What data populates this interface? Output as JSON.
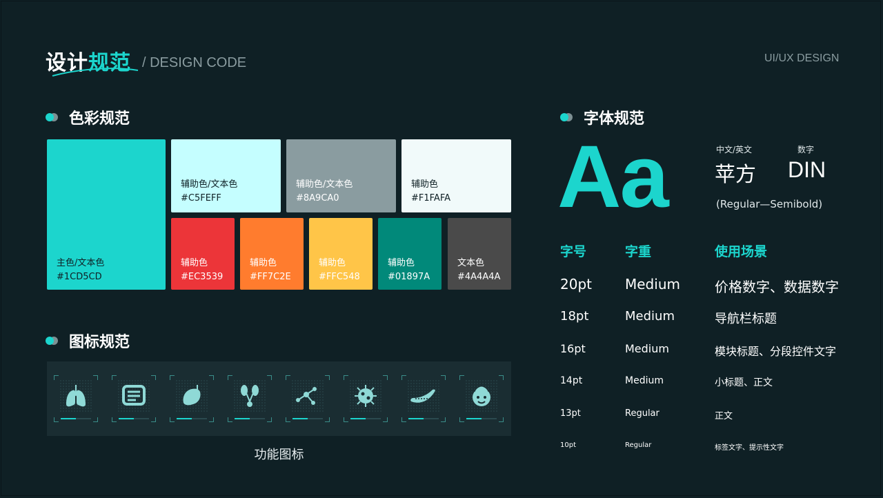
{
  "header": {
    "title_main": "设计",
    "title_accent": "规范",
    "subtitle": "/ DESIGN CODE",
    "right_label": "UI/UX DESIGN"
  },
  "colors_section": {
    "title": "色彩规范",
    "swatches": [
      {
        "name": "主色/文本色",
        "hex": "#1CD5CD",
        "bg": "#1CD5CD",
        "fg": "#0f2025"
      },
      {
        "name": "辅助色/文本色",
        "hex": "#C5FEFF",
        "bg": "#C5FEFF",
        "fg": "#0f2025"
      },
      {
        "name": "辅助色/文本色",
        "hex": "#8A9CA0",
        "bg": "#8A9CA0",
        "fg": "#ffffff"
      },
      {
        "name": "辅助色",
        "hex": "#F1FAFA",
        "bg": "#F1FAFA",
        "fg": "#0f2025"
      },
      {
        "name": "辅助色",
        "hex": "#EC3539",
        "bg": "#EC3539",
        "fg": "#ffffff"
      },
      {
        "name": "辅助色",
        "hex": "#FF7C2E",
        "bg": "#FF7C2E",
        "fg": "#ffffff"
      },
      {
        "name": "辅助色",
        "hex": "#FFC548",
        "bg": "#FFC548",
        "fg": "#ffffff"
      },
      {
        "name": "辅助色",
        "hex": "#01897A",
        "bg": "#01897A",
        "fg": "#ffffff"
      },
      {
        "name": "文本色",
        "hex": "#4A4A4A",
        "bg": "#4A4A4A",
        "fg": "#ffffff"
      }
    ]
  },
  "icons_section": {
    "title": "图标规范",
    "caption": "功能图标",
    "icons": [
      "lungs-icon",
      "intestine-icon",
      "liver-icon",
      "kidney-icon",
      "molecule-icon",
      "virus-icon",
      "pancreas-icon",
      "baby-face-icon"
    ]
  },
  "fonts_section": {
    "title": "字体规范",
    "sample": "Aa",
    "cn_en_label": "中文/英文",
    "digits_label": "数字",
    "cn_font": "苹方",
    "digit_font": "DIN",
    "weights": "(Regular—Semibold)",
    "headers": {
      "size": "字号",
      "weight": "字重",
      "usage": "使用场景"
    },
    "rows": [
      {
        "size": "20pt",
        "weight": "Medium",
        "usage": "价格数字、数据数字"
      },
      {
        "size": "18pt",
        "weight": "Medium",
        "usage": "导航栏标题"
      },
      {
        "size": "16pt",
        "weight": "Medium",
        "usage": "模块标题、分段控件文字"
      },
      {
        "size": "14pt",
        "weight": "Medium",
        "usage": "小标题、正文"
      },
      {
        "size": "13pt",
        "weight": "Regular",
        "usage": "正文"
      },
      {
        "size": "10pt",
        "weight": "Regular",
        "usage": "标签文字、提示性文字"
      }
    ]
  },
  "accent_color": "#1CD5CD",
  "background_color": "#0F2025"
}
